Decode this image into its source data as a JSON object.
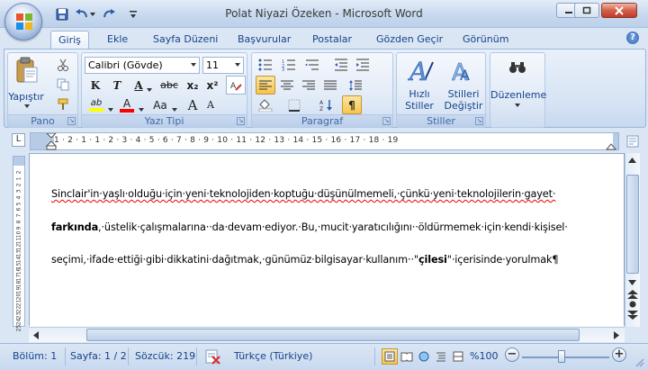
{
  "window": {
    "title": "Polat Niyazi Özeken - Microsoft Word"
  },
  "tabs": [
    "Giriş",
    "Ekle",
    "Sayfa Düzeni",
    "Başvurular",
    "Postalar",
    "Gözden Geçir",
    "Görünüm"
  ],
  "help": "?",
  "ribbon": {
    "pano": {
      "label": "Pano",
      "paste_label": "Yapıştır"
    },
    "font": {
      "label": "Yazı Tipi",
      "font_name": "Calibri (Gövde)",
      "font_size": "11",
      "bold": "K",
      "italic": "T",
      "underline": "A",
      "strike": "abc",
      "sub": "x₂",
      "sup": "x²",
      "grow": "A",
      "shrink": "A",
      "case": "Aa",
      "highlight": "ab",
      "color": "A"
    },
    "paragraph": {
      "label": "Paragraf",
      "pilcrow": "¶"
    },
    "styles": {
      "label": "Stiller",
      "quick_styles_line1": "Hızlı",
      "quick_styles_line2": "Stiller",
      "change_styles_line1": "Stilleri",
      "change_styles_line2": "Değiştir"
    },
    "editing": {
      "label": "Düzenleme"
    }
  },
  "ruler": {
    "tab_selector": "L",
    "marks": "1 · 2 · 1 · 1 · 2 · 3 · 4 · 5 · 6 · 7 · 8 · 9 · 10 · 11 · 12 · 13 · 14 · 15 · 16 · 17 · 18 · 19",
    "vertical_marks": [
      "2",
      "1",
      "2",
      "3",
      "4",
      "5",
      "6",
      "7",
      "8",
      "9",
      "10",
      "11",
      "12",
      "13",
      "14",
      "15",
      "16",
      "17",
      "18",
      "19",
      "20",
      "21",
      "22",
      "23",
      "24",
      "25"
    ]
  },
  "document": {
    "line1": "Sinclair'in·yaşlı·olduğu·için·yeni·teknolojiden·koptuğu·düşünülmemeli,·çünkü·yeni·teknolojilerin·gayet·",
    "line2_bold": "farkında",
    "line2_rest": ",·üstelik·çalışmalarına··da·devam·ediyor.·Bu,·mucit·yaratıcılığını··öldürmemek·için·kendi·kişisel·",
    "line3_a": "seçimi,·ifade·ettiği·gibi·dikkatini·dağıtmak,·günümüz·bilgisayar·kullanım··\"",
    "line3_bold": "çilesi",
    "line3_b": "\"·içerisinde·yorulmak",
    "line3_end": "¶"
  },
  "status": {
    "section": "Bölüm: 1",
    "page": "Sayfa: 1 / 2",
    "words": "Sözcük: 219",
    "language": "Türkçe (Türkiye)",
    "zoom": "%100",
    "zoom_minus": "−",
    "zoom_plus": "+"
  },
  "colors": {
    "ribbon_text": "#15428b",
    "highlight": "#ffff00",
    "font_color": "#ff0000",
    "active": "#f8c44b"
  }
}
